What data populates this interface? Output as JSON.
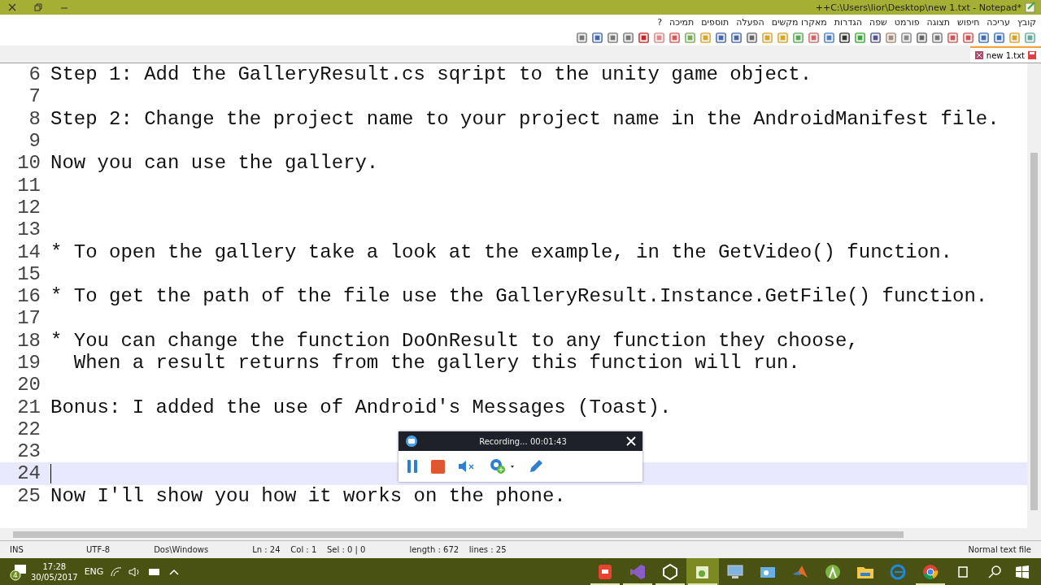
{
  "window": {
    "title": "++C:\\Users\\lior\\Desktop\\new 1.txt - Notepad*"
  },
  "menu": [
    "קובץ",
    "עריכה",
    "חיפוש",
    "תצוגה",
    "פורמט",
    "שפה",
    "הגדרות",
    "מאקרו מקשים",
    "הפעלה",
    "תוספים",
    "תמיכה",
    "?"
  ],
  "tabs": [
    {
      "label": "new 1.txt",
      "selected": true,
      "modified": true
    }
  ],
  "editor": {
    "lines": [
      {
        "number": "6",
        "text": "Step 1: Add the GalleryResult.cs sqript to the unity game object.",
        "current": false
      },
      {
        "number": "7",
        "current": false
      },
      {
        "number": "8",
        "text": "Step 2: Change the project name to your project name in the AndroidManifest file.",
        "current": false
      },
      {
        "number": "9",
        "current": false
      },
      {
        "number": "10",
        "text": "Now you can use the gallery.",
        "current": false
      },
      {
        "number": "11",
        "current": false
      },
      {
        "number": "12",
        "current": false
      },
      {
        "number": "13",
        "current": false
      },
      {
        "number": "14",
        "text": "* To open the gallery take a look at the example, in the GetVideo() function.",
        "current": false
      },
      {
        "number": "15",
        "current": false
      },
      {
        "number": "16",
        "text": "* To get the path of the file use the GalleryResult.Instance.GetFile() function.",
        "current": false
      },
      {
        "number": "17",
        "current": false
      },
      {
        "number": "18",
        "text": "* You can change the function DoOnResult to any function they choose,",
        "current": false
      },
      {
        "number": "19",
        "text": "  When a result returns from the gallery this function will run.",
        "current": false
      },
      {
        "number": "20",
        "current": false
      },
      {
        "number": "21",
        "text": "Bonus: I added the use of Android's Messages (Toast).",
        "current": false
      },
      {
        "number": "22",
        "current": false
      },
      {
        "number": "23",
        "current": false
      },
      {
        "number": "24",
        "current": true
      },
      {
        "number": "25",
        "text": "Now I'll show you how it works on the phone.",
        "current": false
      }
    ]
  },
  "recorder": {
    "status": "Recording... 00:01:43",
    "muted": true
  },
  "status_bar": {
    "insert_mode": "INS",
    "encoding": "UTF-8",
    "line_endings": "Dos\\Windows",
    "position": "Ln : 24    Col : 1    Sel : 0 | 0",
    "size": "length : 672    lines : 25",
    "file_type": "Normal text file"
  },
  "taskbar": {
    "notifications": "4",
    "time": "17:28",
    "date": "30/05/2017",
    "language": "ENG",
    "apps": [
      {
        "kind": "memo",
        "running": true,
        "selected": false
      },
      {
        "kind": "studio",
        "running": true,
        "selected": false
      },
      {
        "kind": "unity",
        "running": true,
        "selected": false
      },
      {
        "kind": "notepad",
        "running": true,
        "selected": true
      },
      {
        "kind": "monitor",
        "running": false,
        "selected": false
      },
      {
        "kind": "window",
        "running": false,
        "selected": false
      },
      {
        "kind": "matlab",
        "running": false,
        "selected": false
      },
      {
        "kind": "android",
        "running": false,
        "selected": false
      },
      {
        "kind": "folder",
        "running": false,
        "selected": false
      },
      {
        "kind": "edge",
        "running": false,
        "selected": false
      },
      {
        "kind": "chrome",
        "running": true,
        "selected": false
      }
    ]
  }
}
